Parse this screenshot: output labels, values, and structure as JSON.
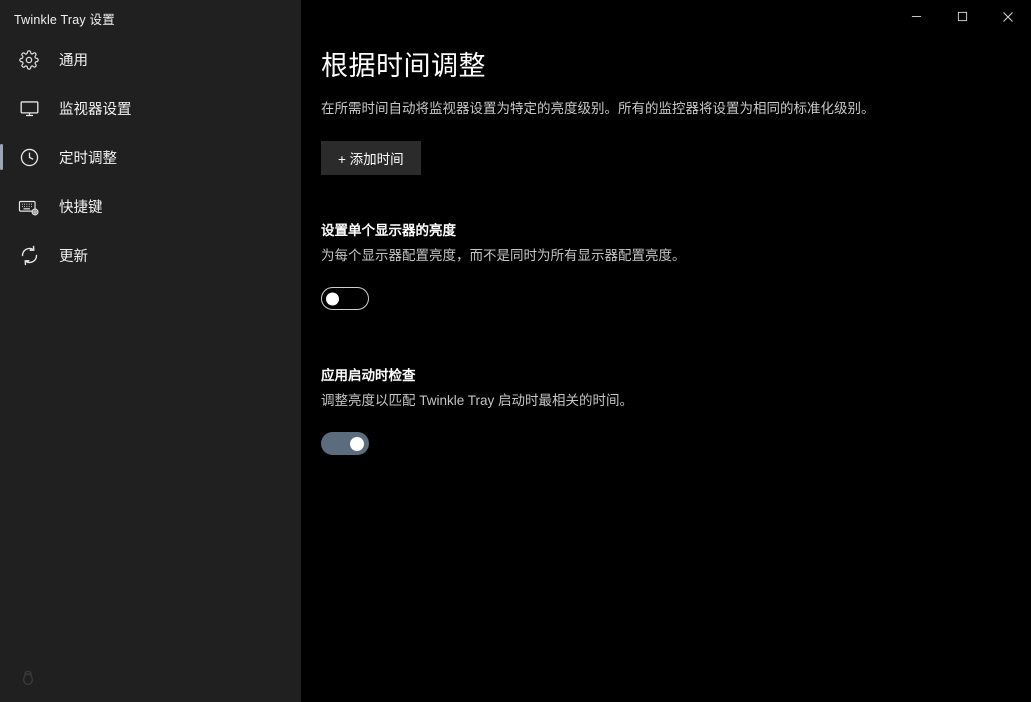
{
  "window": {
    "title": "Twinkle Tray 设置",
    "controls": {
      "minimize": "minimize-icon",
      "maximize": "maximize-icon",
      "close": "close-icon"
    }
  },
  "sidebar": {
    "items": [
      {
        "label": "通用",
        "icon": "gear-icon",
        "active": false
      },
      {
        "label": "监视器设置",
        "icon": "monitor-icon",
        "active": false
      },
      {
        "label": "定时调整",
        "icon": "clock-icon",
        "active": true
      },
      {
        "label": "快捷键",
        "icon": "keyboard-shortcut-icon",
        "active": false
      },
      {
        "label": "更新",
        "icon": "refresh-icon",
        "active": false
      }
    ],
    "debug_icon": "bug-icon"
  },
  "main": {
    "page_title": "根据时间调整",
    "page_description": "在所需时间自动将监视器设置为特定的亮度级别。所有的监控器将设置为相同的标准化级别。",
    "add_time_button": "+ 添加时间",
    "sections": [
      {
        "title": "设置单个显示器的亮度",
        "description": "为每个显示器配置亮度，而不是同时为所有显示器配置亮度。",
        "toggle_state": "off"
      },
      {
        "title": "应用启动时检查",
        "description": "调整亮度以匹配 Twinkle Tray 启动时最相关的时间。",
        "toggle_state": "on"
      }
    ]
  },
  "colors": {
    "sidebar_bg": "#202020",
    "content_bg": "#000000",
    "accent_active": "#9aa6b2",
    "toggle_on": "#5a6c7d",
    "button_bg": "#2b2b2b"
  }
}
